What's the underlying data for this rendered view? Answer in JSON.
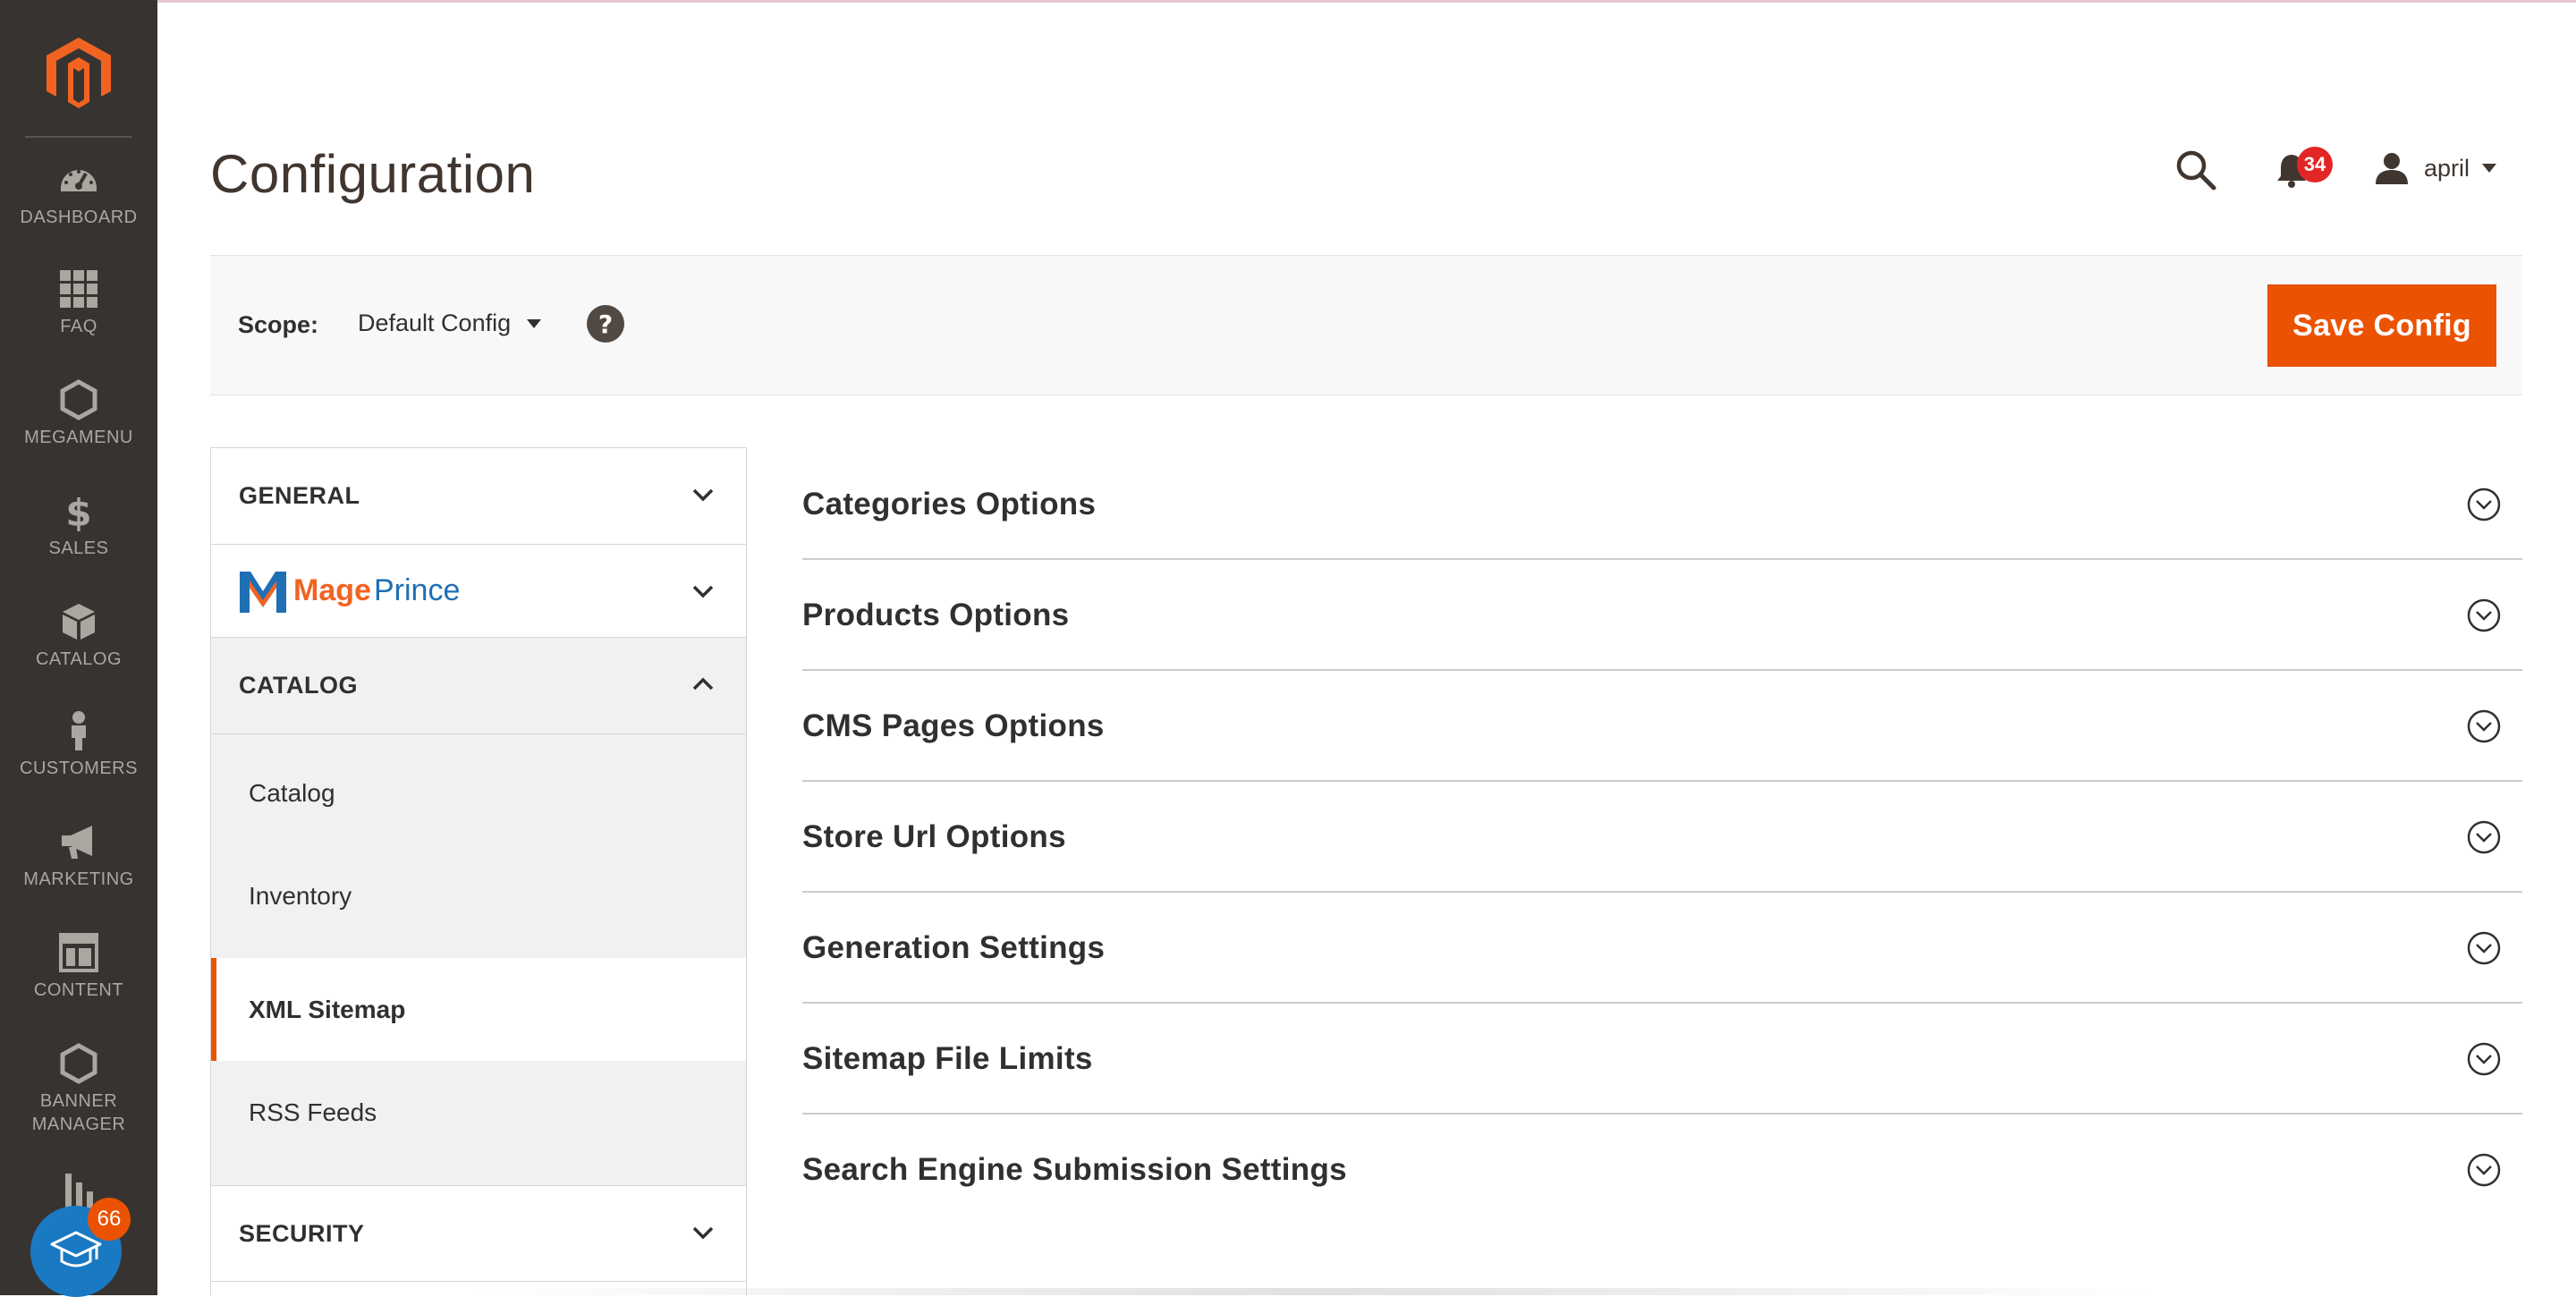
{
  "nav": {
    "items": [
      {
        "label": "DASHBOARD",
        "icon": "dashboard-gauge-icon"
      },
      {
        "label": "FAQ",
        "icon": "grid-icon"
      },
      {
        "label": "MEGAMENU",
        "icon": "hexagon-icon"
      },
      {
        "label": "SALES",
        "icon": "dollar-icon"
      },
      {
        "label": "CATALOG",
        "icon": "box-icon"
      },
      {
        "label": "CUSTOMERS",
        "icon": "person-icon"
      },
      {
        "label": "MARKETING",
        "icon": "megaphone-icon"
      },
      {
        "label": "CONTENT",
        "icon": "layout-icon"
      },
      {
        "label": "BANNER MANAGER",
        "icon": "hexagon-icon"
      },
      {
        "label": "",
        "icon": "bar-chart-icon"
      }
    ],
    "education_badge": "66"
  },
  "header": {
    "title": "Configuration",
    "notifications_count": "34",
    "username": "april"
  },
  "scope": {
    "label": "Scope:",
    "value": "Default Config",
    "save_label": "Save Config"
  },
  "tabs": {
    "general": "GENERAL",
    "mageprince": {
      "mage": "Mage",
      "prince": "Prince"
    },
    "catalog": "CATALOG",
    "catalog_items": [
      "Catalog",
      "Inventory",
      "XML Sitemap",
      "RSS Feeds"
    ],
    "security": "SECURITY"
  },
  "sections": [
    "Categories Options",
    "Products Options",
    "CMS Pages Options",
    "Store Url Options",
    "Generation Settings",
    "Sitemap File Limits",
    "Search Engine Submission Settings"
  ],
  "colors": {
    "accent": "#eb5202",
    "nav_bg": "#373330",
    "badge_red": "#e22626",
    "edu_blue": "#1979c3"
  }
}
